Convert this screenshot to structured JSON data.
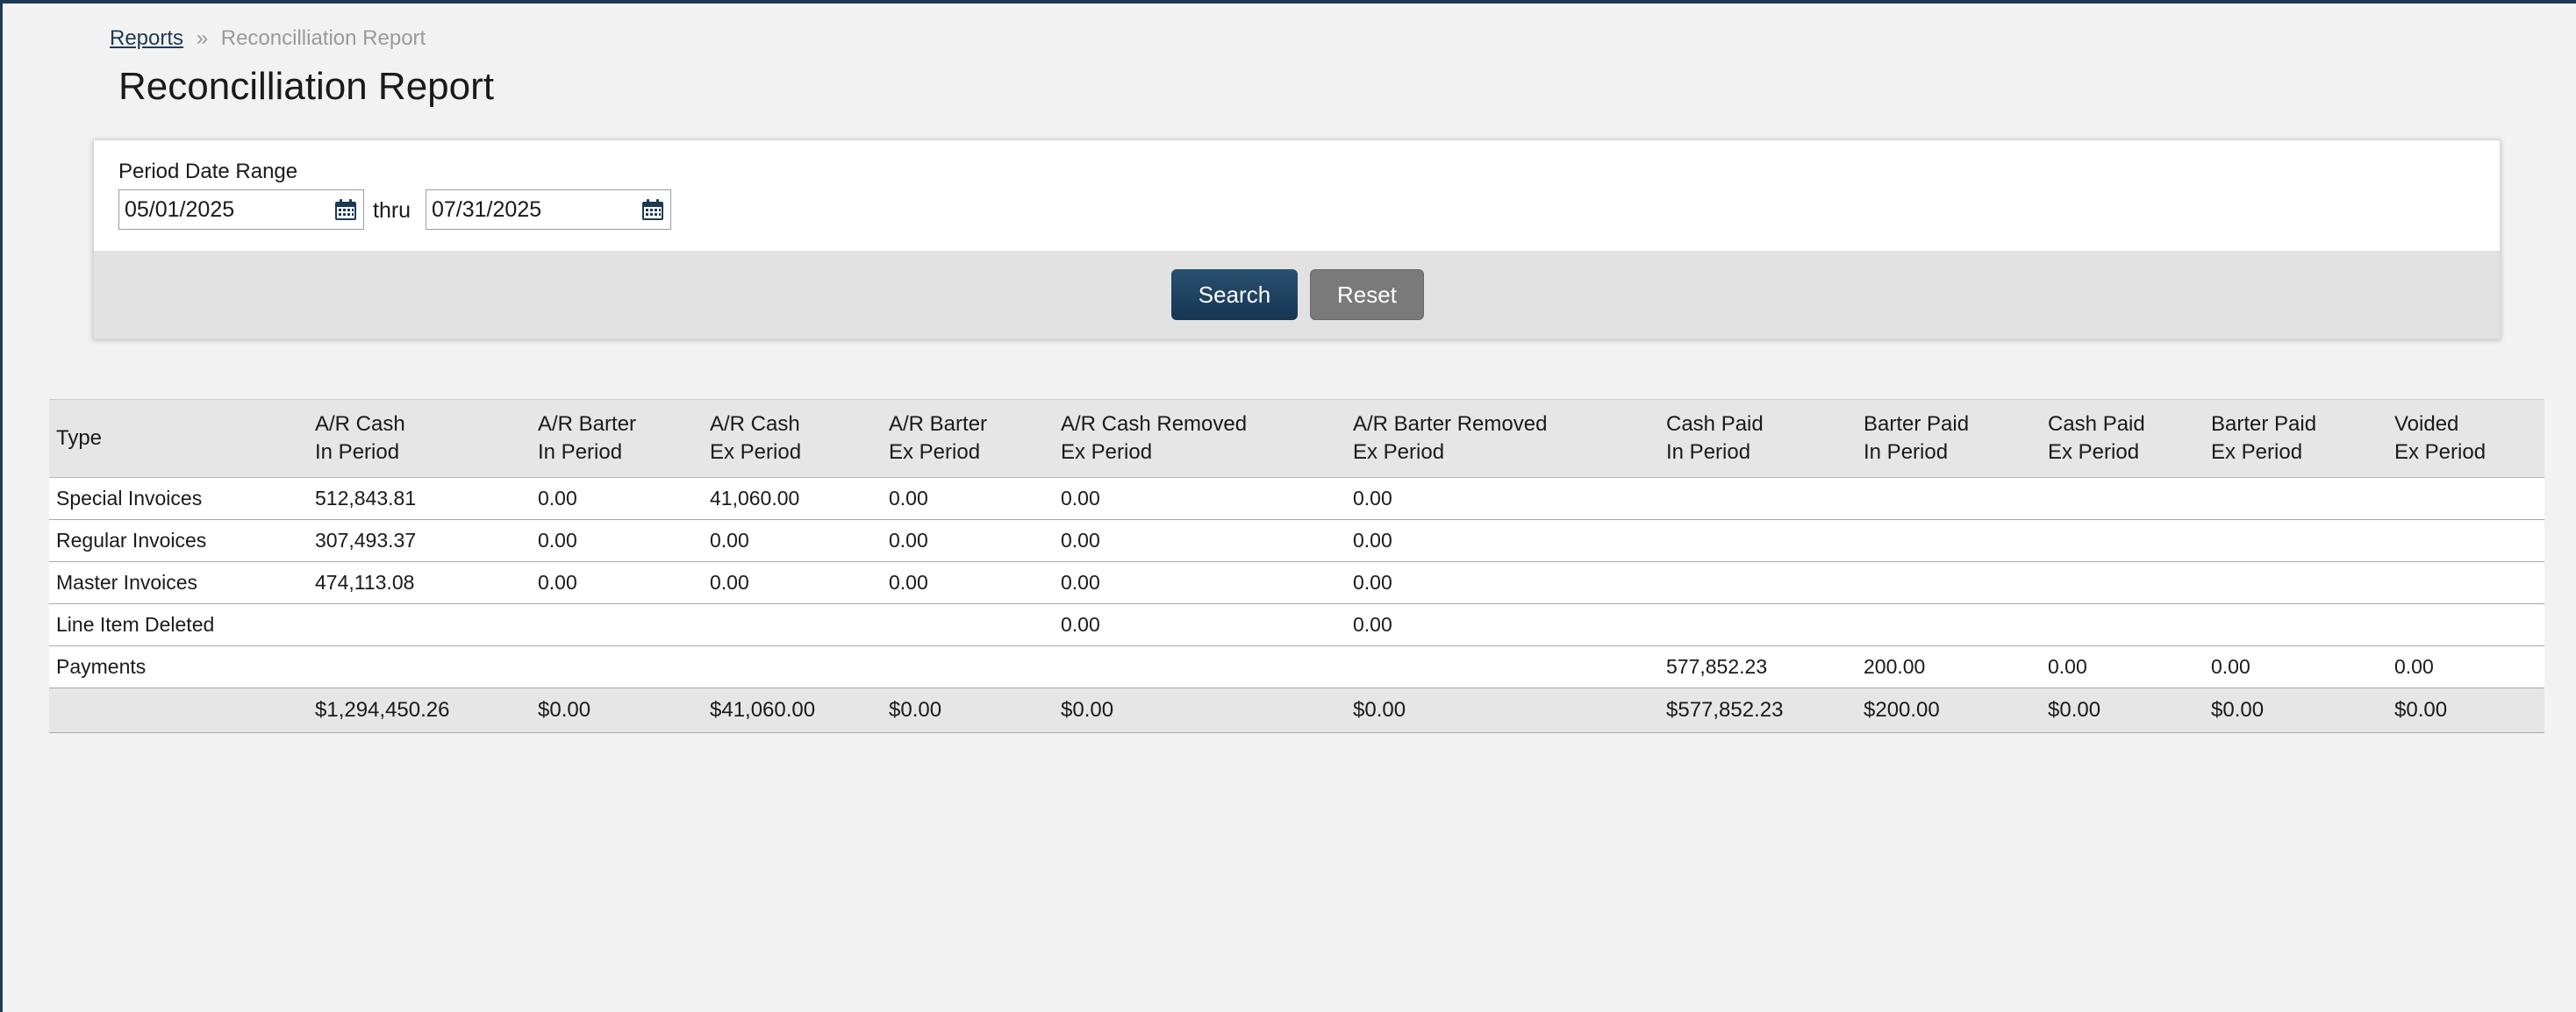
{
  "breadcrumb": {
    "parent": "Reports",
    "separator": "»",
    "current": "Reconcilliation Report"
  },
  "page_title": "Reconcilliation Report",
  "filter": {
    "label": "Period Date Range",
    "from_value": "05/01/2025",
    "thru_label": "thru",
    "to_value": "07/31/2025",
    "search_label": "Search",
    "reset_label": "Reset"
  },
  "colors": {
    "accent": "#1d3a55",
    "search_button": "#1f4463",
    "reset_button": "#7a7a7a",
    "header_bg": "#e6e6e6"
  },
  "icons": {
    "calendar": "calendar-icon"
  },
  "table": {
    "headers": [
      [
        "Type",
        ""
      ],
      [
        "A/R Cash",
        "In Period"
      ],
      [
        "A/R Barter",
        "In Period"
      ],
      [
        "A/R Cash",
        "Ex Period"
      ],
      [
        "A/R Barter",
        "Ex Period"
      ],
      [
        "A/R Cash Removed",
        "Ex Period"
      ],
      [
        "A/R Barter Removed",
        "Ex Period"
      ],
      [
        "Cash Paid",
        "In Period"
      ],
      [
        "Barter Paid",
        "In Period"
      ],
      [
        "Cash Paid",
        "Ex Period"
      ],
      [
        "Barter Paid",
        "Ex Period"
      ],
      [
        "Voided",
        "Ex Period"
      ]
    ],
    "rows": [
      [
        "Special Invoices",
        "512,843.81",
        "0.00",
        "41,060.00",
        "0.00",
        "0.00",
        "0.00",
        "",
        "",
        "",
        "",
        ""
      ],
      [
        "Regular Invoices",
        "307,493.37",
        "0.00",
        "0.00",
        "0.00",
        "0.00",
        "0.00",
        "",
        "",
        "",
        "",
        ""
      ],
      [
        "Master Invoices",
        "474,113.08",
        "0.00",
        "0.00",
        "0.00",
        "0.00",
        "0.00",
        "",
        "",
        "",
        "",
        ""
      ],
      [
        "Line Item Deleted",
        "",
        "",
        "",
        "",
        "0.00",
        "0.00",
        "",
        "",
        "",
        "",
        ""
      ],
      [
        "Payments",
        "",
        "",
        "",
        "",
        "",
        "",
        "577,852.23",
        "200.00",
        "0.00",
        "0.00",
        "0.00"
      ]
    ],
    "totals": [
      "",
      "$1,294,450.26",
      "$0.00",
      "$41,060.00",
      "$0.00",
      "$0.00",
      "$0.00",
      "$577,852.23",
      "$200.00",
      "$0.00",
      "$0.00",
      "$0.00"
    ]
  }
}
